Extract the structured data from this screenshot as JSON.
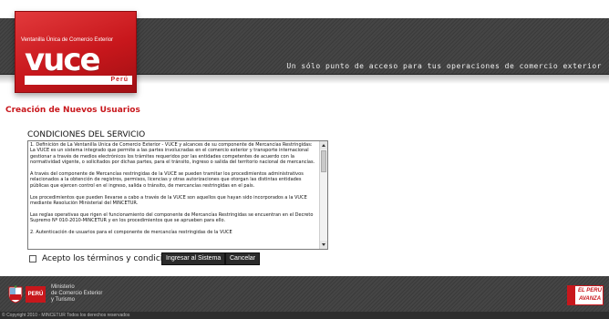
{
  "header": {
    "tagline": "Un sólo punto de acceso para tus operaciones de comercio exterior"
  },
  "logo": {
    "subtitle": "Ventanilla Única de Comercio Exterior",
    "word": "vuce",
    "country": "Perú",
    "brand_color": "#c8171c"
  },
  "page": {
    "title": "Creación de Nuevos Usuarios"
  },
  "terms": {
    "heading": "CONDICIONES DEL SERVICIO",
    "paragraphs": [
      "1. Definición de La Ventanilla Única de Comercio Exterior - VUCE y alcances de su componente de Mercancías Restringidas: La VUCE es un sistema integrado que permite a las partes involucradas en el comercio exterior y transporte internacional gestionar a través de medios electrónicos los trámites requeridos por las entidades competentes de acuerdo con la normatividad vigente, o solicitados por dichas partes, para el tránsito, ingreso o salida del territorio nacional de mercancías.",
      "A través del componente de Mercancías restringidas de la VUCE se pueden tramitar los procedimientos administrativos relacionados a la obtención de registros, permisos, licencias y otras autorizaciones que otorgan las distintas entidades públicas que ejercen control en el ingreso, salida o tránsito, de mercancías restringidas en el país.",
      "Los procedimientos que pueden llevarse a cabo a través de la VUCE son aquellos que hayan sido incorporados a la VUCE mediante Resolución Ministerial del MINCETUR.",
      "Las reglas operativas que rigen el funcionamiento del componente de Mercancías Restringidas se encuentran en el Decreto Supremo Nº 010-2010-MINCETUR y en los procedimientos que se aprueben para ello.",
      "2. Autenticación de usuarios para el componente de mercancías restringidas de la VUCE"
    ]
  },
  "form": {
    "accept_label": "Acepto los términos y condiciones",
    "accept_checked": false,
    "login_button": "Ingresar al Sistema",
    "cancel_button": "Cancelar"
  },
  "footer": {
    "country_label": "PERÚ",
    "ministry_line1": "Ministerio",
    "ministry_line2": "de Comercio Exterior",
    "ministry_line3": "y Turismo",
    "avanza_line1": "EL PERÚ",
    "avanza_line2": "AVANZA",
    "copyright": "© Copyright 2010 - MINCETUR Todos los derechos reservados"
  }
}
